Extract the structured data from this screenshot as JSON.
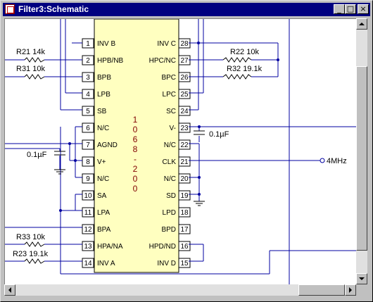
{
  "window": {
    "title": "Filter3:Schematic"
  },
  "titlebar_buttons": {
    "minimize": "_",
    "maximize": "□",
    "close": "×"
  },
  "chip": {
    "label_chars": [
      "1",
      "0",
      "6",
      "8",
      "-",
      "2",
      "0",
      "0"
    ],
    "left_pins": [
      {
        "num": "1",
        "name": "INV B"
      },
      {
        "num": "2",
        "name": "HPB/NB"
      },
      {
        "num": "3",
        "name": "BPB"
      },
      {
        "num": "4",
        "name": "LPB"
      },
      {
        "num": "5",
        "name": "SB"
      },
      {
        "num": "6",
        "name": "N/C"
      },
      {
        "num": "7",
        "name": "AGND"
      },
      {
        "num": "8",
        "name": "V+"
      },
      {
        "num": "9",
        "name": "N/C"
      },
      {
        "num": "10",
        "name": "SA"
      },
      {
        "num": "11",
        "name": "LPA"
      },
      {
        "num": "12",
        "name": "BPA"
      },
      {
        "num": "13",
        "name": "HPA/NA"
      },
      {
        "num": "14",
        "name": "INV A"
      }
    ],
    "right_pins": [
      {
        "num": "28",
        "name": "INV C"
      },
      {
        "num": "27",
        "name": "HPC/NC"
      },
      {
        "num": "26",
        "name": "BPC"
      },
      {
        "num": "25",
        "name": "LPC"
      },
      {
        "num": "24",
        "name": "SC"
      },
      {
        "num": "23",
        "name": "V-"
      },
      {
        "num": "22",
        "name": "N/C"
      },
      {
        "num": "21",
        "name": "CLK"
      },
      {
        "num": "20",
        "name": "N/C"
      },
      {
        "num": "19",
        "name": "SD"
      },
      {
        "num": "18",
        "name": "LPD"
      },
      {
        "num": "17",
        "name": "BPD"
      },
      {
        "num": "16",
        "name": "HPD/ND"
      },
      {
        "num": "15",
        "name": "INV D"
      }
    ]
  },
  "components": {
    "r21": "R21 14k",
    "r31": "R31 10k",
    "r22": "R22 10k",
    "r32": "R32 19.1k",
    "r33": "R33 10k",
    "r23": "R23 19.1k",
    "cap_left": "0.1µF",
    "cap_right": "0.1µF",
    "clock_port": "4MHz"
  },
  "colors": {
    "wire": "#0000a0",
    "chip_fill": "#ffffc0",
    "chip_text": "#800000",
    "titlebar": "#000080"
  }
}
